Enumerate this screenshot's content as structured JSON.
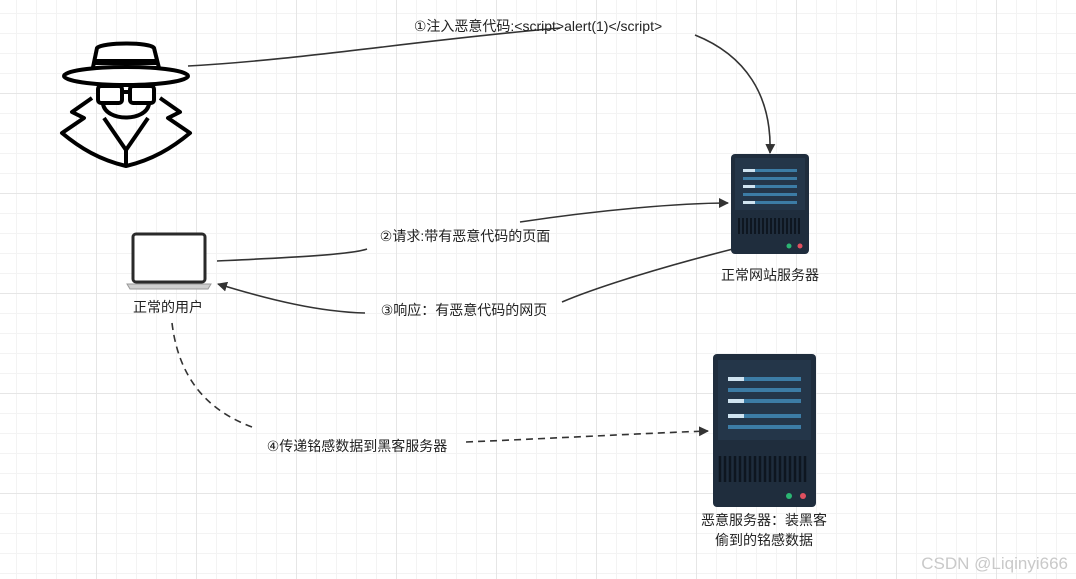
{
  "step1_label": "①注入恶意代码:<script>alert(1)</script>",
  "step2_label": "②请求:带有恶意代码的页面",
  "step3_label": "③响应：有恶意代码的网页",
  "step4_label": "④传递铭感数据到黑客服务器",
  "web_server_label": "正常网站服务器",
  "user_label": "正常的用户",
  "malicious_server_label_line1": "恶意服务器：装黑客",
  "malicious_server_label_line2": "偷到的铭感数据",
  "watermark": "CSDN @Liqinyi666",
  "colors": {
    "server_body": "#1f2d3d",
    "server_bar": "#3c7ca5",
    "led_green": "#2bb673",
    "led_red": "#e0505f",
    "line": "#333333"
  }
}
